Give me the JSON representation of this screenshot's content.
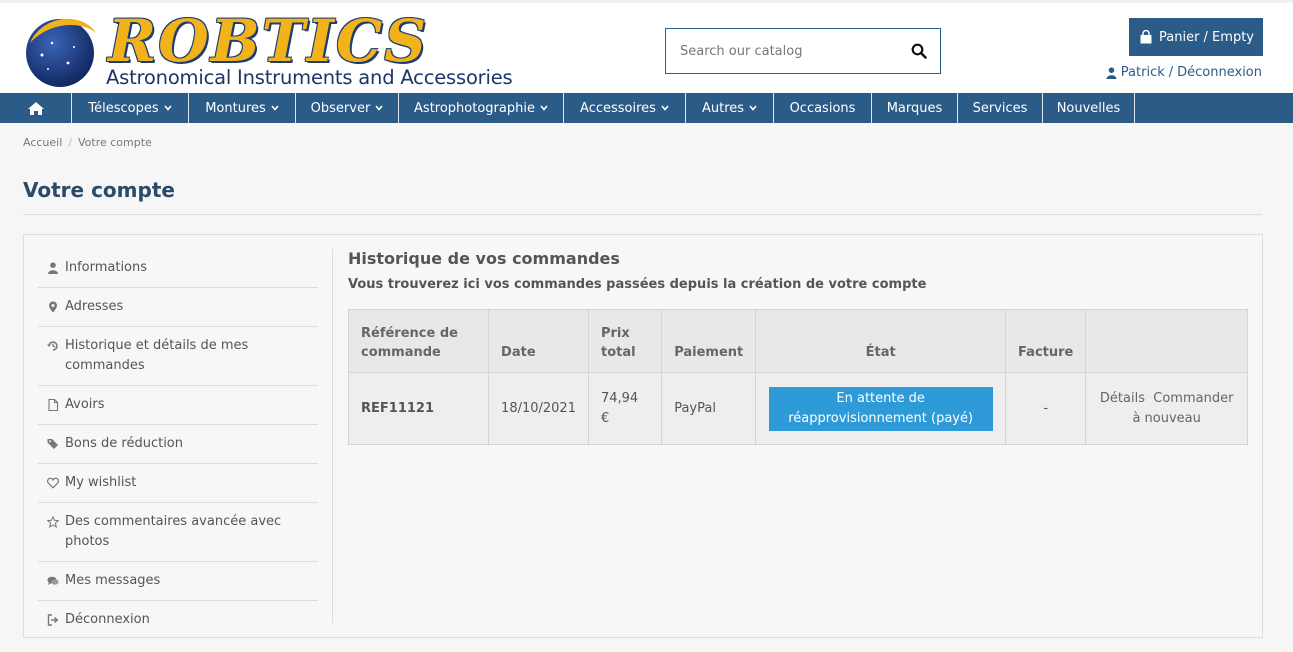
{
  "brand": {
    "name": "ROBTICS",
    "tagline": "Astronomical Instruments and Accessories"
  },
  "search": {
    "placeholder": "Search our catalog",
    "icon": "search-icon"
  },
  "cart": {
    "label": "Panier / Empty",
    "icon": "shopping-bag-icon"
  },
  "user": {
    "name": "Patrick",
    "separator": "/",
    "logout": "Déconnexion",
    "icon": "user-icon"
  },
  "nav": {
    "home_icon": "home-icon",
    "items": [
      {
        "label": "Télescopes",
        "dropdown": true
      },
      {
        "label": "Montures",
        "dropdown": true
      },
      {
        "label": "Observer",
        "dropdown": true
      },
      {
        "label": "Astrophotographie",
        "dropdown": true
      },
      {
        "label": "Accessoires",
        "dropdown": true
      },
      {
        "label": "Autres",
        "dropdown": true
      },
      {
        "label": "Occasions",
        "dropdown": false
      },
      {
        "label": "Marques",
        "dropdown": false
      },
      {
        "label": "Services",
        "dropdown": false
      },
      {
        "label": "Nouvelles",
        "dropdown": false
      }
    ]
  },
  "breadcrumb": {
    "items": [
      "Accueil",
      "Votre compte"
    ],
    "separator": "/"
  },
  "page": {
    "title": "Votre compte"
  },
  "sidebar": {
    "items": [
      {
        "label": "Informations",
        "icon": "user-icon"
      },
      {
        "label": "Adresses",
        "icon": "map-marker-icon"
      },
      {
        "label": "Historique et détails de mes commandes",
        "icon": "history-icon"
      },
      {
        "label": "Avoirs",
        "icon": "file-icon"
      },
      {
        "label": "Bons de réduction",
        "icon": "tags-icon"
      },
      {
        "label": "My wishlist",
        "icon": "heart-icon"
      },
      {
        "label": "Des commentaires avancée avec photos",
        "icon": "star-icon"
      },
      {
        "label": "Mes messages",
        "icon": "comments-icon"
      },
      {
        "label": "Déconnexion",
        "icon": "sign-out-icon"
      }
    ]
  },
  "history": {
    "title": "Historique de vos commandes",
    "subtitle": "Vous trouverez ici vos commandes passées depuis la création de votre compte",
    "columns": [
      "Référence de commande",
      "Date",
      "Prix total",
      "Paiement",
      "État",
      "Facture",
      ""
    ],
    "rows": [
      {
        "reference": "REF11121",
        "date": "18/10/2021",
        "total": "74,94 €",
        "payment": "PayPal",
        "state": "En attente de réapprovisionnement (payé)",
        "invoice": "-",
        "details": "Détails",
        "reorder": "Commander à nouveau"
      }
    ]
  },
  "colors": {
    "primary": "#2b5b87",
    "status": "#2f9ad8",
    "logo_gold": "#f2b21a",
    "logo_navy": "#1c3668"
  }
}
